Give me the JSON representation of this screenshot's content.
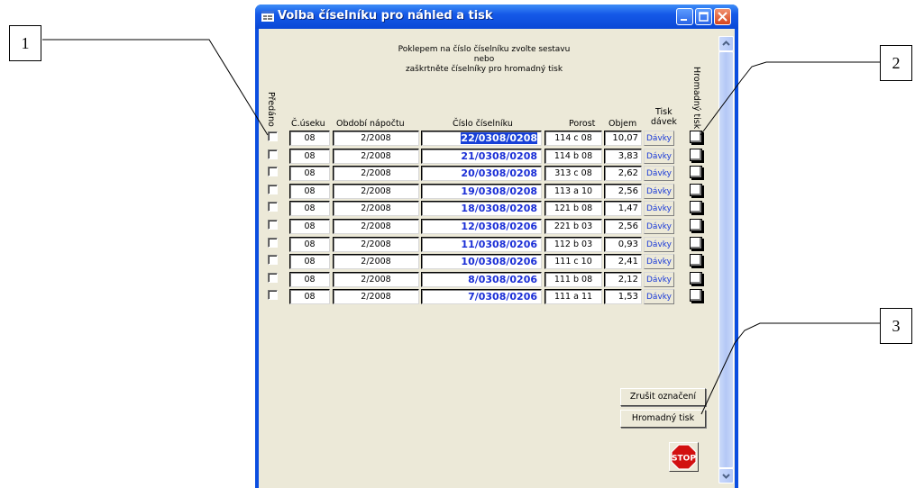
{
  "window": {
    "title": "Volba  číselníku pro náhled a tisk",
    "instructions": {
      "line1": "Poklepem na číslo číselníku zvolte sestavu",
      "line2": "nebo",
      "line3": "zaškrtněte číselníky pro hromadný tisk"
    },
    "headers": {
      "predano": "Předáno",
      "usek": "Č.úseku",
      "obdobi": "Období nápočtu",
      "cislo": "Číslo číselníku",
      "porost": "Porost",
      "objem": "Objem",
      "tisk": "Tisk",
      "davek": "dávek",
      "hromadny": "Hromadný tisk"
    },
    "rows": [
      {
        "usek": "08",
        "obdobi": "2/2008",
        "cislo": "22/0308/0208",
        "porost": "114 c 08",
        "objem": "10,07",
        "davky": "Dávky",
        "selected": true
      },
      {
        "usek": "08",
        "obdobi": "2/2008",
        "cislo": "21/0308/0208",
        "porost": "114 b 08",
        "objem": "3,83",
        "davky": "Dávky"
      },
      {
        "usek": "08",
        "obdobi": "2/2008",
        "cislo": "20/0308/0208",
        "porost": "313 c 08",
        "objem": "2,62",
        "davky": "Dávky"
      },
      {
        "usek": "08",
        "obdobi": "2/2008",
        "cislo": "19/0308/0208",
        "porost": "113 a 10",
        "objem": "2,56",
        "davky": "Dávky"
      },
      {
        "usek": "08",
        "obdobi": "2/2008",
        "cislo": "18/0308/0208",
        "porost": "121 b 08",
        "objem": "1,47",
        "davky": "Dávky"
      },
      {
        "usek": "08",
        "obdobi": "2/2008",
        "cislo": "12/0308/0206",
        "porost": "221 b 03",
        "objem": "2,56",
        "davky": "Dávky"
      },
      {
        "usek": "08",
        "obdobi": "2/2008",
        "cislo": "11/0308/0206",
        "porost": "112 b 03",
        "objem": "0,93",
        "davky": "Dávky"
      },
      {
        "usek": "08",
        "obdobi": "2/2008",
        "cislo": "10/0308/0206",
        "porost": "111 c 10",
        "objem": "2,41",
        "davky": "Dávky"
      },
      {
        "usek": "08",
        "obdobi": "2/2008",
        "cislo": "8/0308/0206",
        "porost": "111 b 08",
        "objem": "2,12",
        "davky": "Dávky"
      },
      {
        "usek": "08",
        "obdobi": "2/2008",
        "cislo": "7/0308/0206",
        "porost": "111 a 11",
        "objem": "1,53",
        "davky": "Dávky"
      }
    ],
    "buttons": {
      "zrusit": "Zrušit označení",
      "hromadny": "Hromadný tisk",
      "stop": "STOP"
    }
  },
  "callouts": [
    "1",
    "2",
    "3"
  ],
  "colors": {
    "titlebar": "#0b4ee0",
    "client": "#ece9d8",
    "link": "#1a3ad8",
    "stop": "#d21010"
  }
}
